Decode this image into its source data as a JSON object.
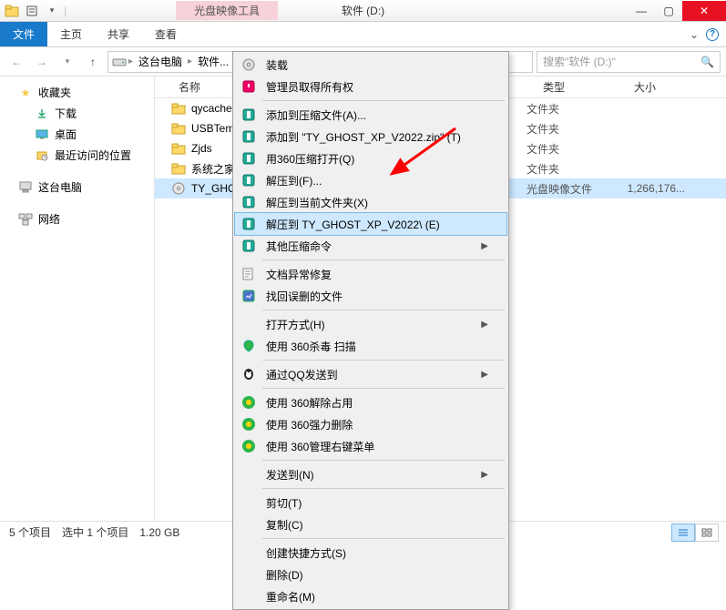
{
  "titlebar": {
    "tool_context": "光盘映像工具",
    "title": "软件 (D:)"
  },
  "ribbon": {
    "file": "文件",
    "home": "主页",
    "share": "共享",
    "view": "查看"
  },
  "nav": {
    "this_pc": "这台电脑",
    "software": "软件...",
    "search_placeholder": "搜索\"软件 (D:)\""
  },
  "sidebar": {
    "fav": "收藏夹",
    "downloads": "下载",
    "desktop": "桌面",
    "recent": "最近访问的位置",
    "this_pc": "这台电脑",
    "network": "网络"
  },
  "columns": {
    "name": "名称",
    "type": "类型",
    "size": "大小"
  },
  "files": [
    {
      "name": "qycache",
      "type": "文件夹",
      "size": "",
      "sel": false,
      "icon": "folder"
    },
    {
      "name": "USBTem",
      "type": "文件夹",
      "size": "",
      "sel": false,
      "icon": "folder"
    },
    {
      "name": "Zjds",
      "type": "文件夹",
      "size": "",
      "sel": false,
      "icon": "folder"
    },
    {
      "name": "系统之家",
      "type": "文件夹",
      "size": "",
      "sel": false,
      "icon": "folder"
    },
    {
      "name": "TY_GHO",
      "type": "光盘映像文件",
      "size": "1,266,176...",
      "sel": true,
      "icon": "iso"
    }
  ],
  "context_menu": [
    {
      "label": "装载",
      "icon": "mount"
    },
    {
      "label": "管理员取得所有权",
      "icon": "admin"
    },
    {
      "sep": true
    },
    {
      "label": "添加到压缩文件(A)...",
      "icon": "zip"
    },
    {
      "label": "添加到 \"TY_GHOST_XP_V2022.zip\" (T)",
      "icon": "zip"
    },
    {
      "label": "用360压缩打开(Q)",
      "icon": "zip"
    },
    {
      "label": "解压到(F)...",
      "icon": "zip"
    },
    {
      "label": "解压到当前文件夹(X)",
      "icon": "zip"
    },
    {
      "label": "解压到 TY_GHOST_XP_V2022\\ (E)",
      "icon": "zip",
      "hl": true
    },
    {
      "label": "其他压缩命令",
      "icon": "zip",
      "sub": true
    },
    {
      "sep": true
    },
    {
      "label": "文档异常修复",
      "icon": "repair"
    },
    {
      "label": "找回误删的文件",
      "icon": "recover"
    },
    {
      "sep": true
    },
    {
      "label": "打开方式(H)",
      "sub": true
    },
    {
      "label": "使用 360杀毒 扫描",
      "icon": "360av"
    },
    {
      "sep": true
    },
    {
      "label": "通过QQ发送到",
      "icon": "qq",
      "sub": true
    },
    {
      "sep": true
    },
    {
      "label": "使用 360解除占用",
      "icon": "360"
    },
    {
      "label": "使用 360强力删除",
      "icon": "360"
    },
    {
      "label": "使用 360管理右键菜单",
      "icon": "360"
    },
    {
      "sep": true
    },
    {
      "label": "发送到(N)",
      "sub": true
    },
    {
      "sep": true
    },
    {
      "label": "剪切(T)"
    },
    {
      "label": "复制(C)"
    },
    {
      "sep": true
    },
    {
      "label": "创建快捷方式(S)"
    },
    {
      "label": "删除(D)"
    },
    {
      "label": "重命名(M)"
    }
  ],
  "status": {
    "count": "5 个项目",
    "selection": "选中 1 个项目",
    "size": "1.20 GB"
  }
}
